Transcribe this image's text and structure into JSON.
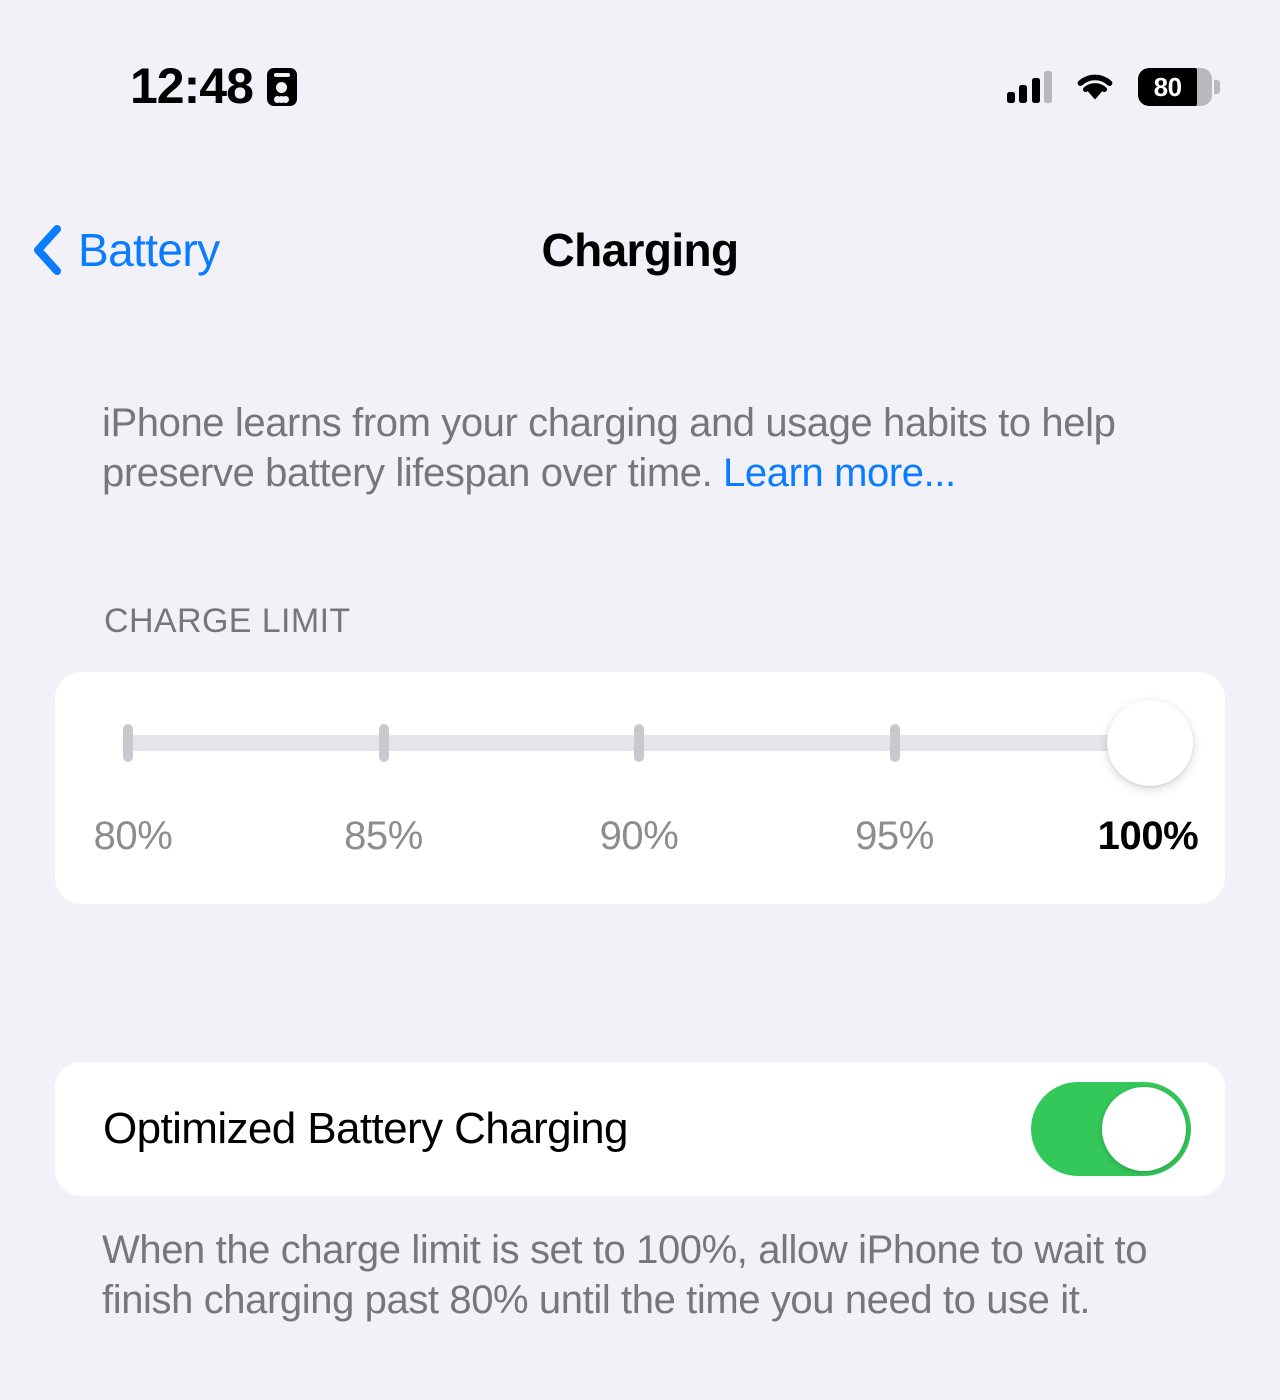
{
  "status_bar": {
    "time": "12:48",
    "focus_icon": "person-id-card-icon",
    "cellular_icon": "cellular-bars-icon",
    "cellular_bars_active": 3,
    "cellular_bars_total": 4,
    "wifi_icon": "wifi-icon",
    "battery_icon": "battery-icon",
    "battery_percent_label": "80",
    "battery_level": 80
  },
  "nav": {
    "back_icon": "chevron-left-icon",
    "back_label": "Battery",
    "title": "Charging"
  },
  "intro": {
    "text": "iPhone learns from your charging and usage habits to help preserve battery lifespan over time. ",
    "link_label": "Learn more..."
  },
  "charge_limit": {
    "section_header": "CHARGE LIMIT",
    "options": [
      {
        "label": "80%",
        "value": 80
      },
      {
        "label": "85%",
        "value": 85
      },
      {
        "label": "90%",
        "value": 90
      },
      {
        "label": "95%",
        "value": 95
      },
      {
        "label": "100%",
        "value": 100
      }
    ],
    "selected_index": 4,
    "selected_label": "100%"
  },
  "optimized_charging": {
    "label": "Optimized Battery Charging",
    "enabled": true,
    "toggle_color": "#34c759"
  },
  "footer": {
    "text": "When the charge limit is set to 100%, allow iPhone to wait to finish charging past 80% until the time you need to use it."
  },
  "colors": {
    "background": "#f2f1f7",
    "card": "#ffffff",
    "accent_blue": "#0a7cff",
    "secondary_text": "#76767c",
    "track": "#e6e5e9",
    "tick": "#c9c8cf"
  }
}
